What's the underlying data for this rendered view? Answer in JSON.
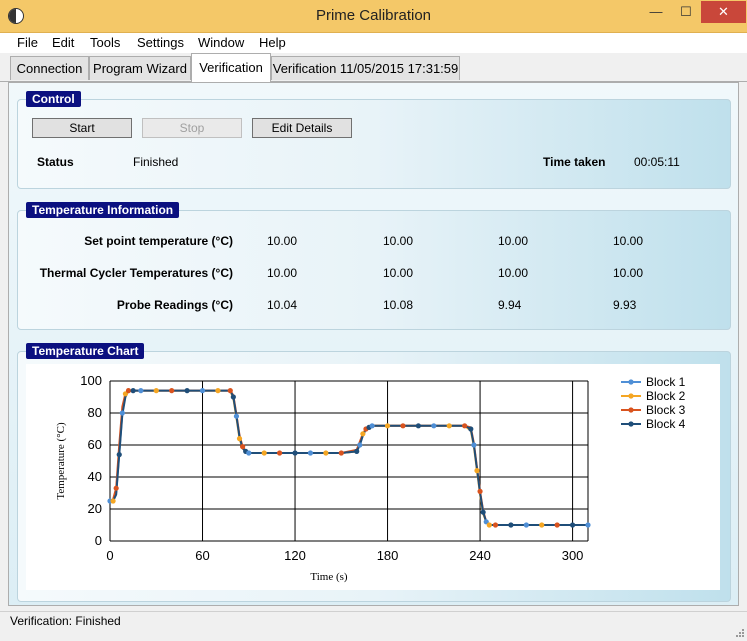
{
  "window": {
    "title": "Prime Calibration",
    "minimize": "—",
    "maximize": "☐",
    "close": "✕"
  },
  "menu": [
    {
      "label": "File"
    },
    {
      "label": "Edit"
    },
    {
      "label": "Tools"
    },
    {
      "label": "Settings"
    },
    {
      "label": "Window"
    },
    {
      "label": "Help"
    }
  ],
  "tabs": [
    {
      "label": "Connection"
    },
    {
      "label": "Program Wizard"
    },
    {
      "label": "Verification"
    },
    {
      "label": "Verification 11/05/2015 17:31:59"
    }
  ],
  "control": {
    "header": "Control",
    "start_label": "Start",
    "stop_label": "Stop",
    "edit_label": "Edit Details",
    "status_label": "Status",
    "status_value": "Finished",
    "time_label": "Time taken",
    "time_value": "00:05:11"
  },
  "temp_info": {
    "header": "Temperature Information",
    "rows": [
      {
        "label": "Set point temperature (°C)",
        "values": [
          "10.00",
          "10.00",
          "10.00",
          "10.00"
        ]
      },
      {
        "label": "Thermal Cycler Temperatures (°C)",
        "values": [
          "10.00",
          "10.00",
          "10.00",
          "10.00"
        ]
      },
      {
        "label": "Probe Readings (°C)",
        "values": [
          "10.04",
          "10.08",
          "9.94",
          "9.93"
        ]
      }
    ]
  },
  "chart_panel": {
    "header": "Temperature Chart"
  },
  "chart_data": {
    "type": "line",
    "xlabel": "Time (s)",
    "ylabel": "Temperature (°C)",
    "xlim": [
      0,
      310
    ],
    "ylim": [
      0,
      100
    ],
    "xticks": [
      0,
      60,
      120,
      180,
      240,
      300
    ],
    "yticks": [
      0,
      20,
      40,
      60,
      80,
      100
    ],
    "grid": true,
    "legend": "top-right",
    "x": [
      0,
      2,
      4,
      6,
      8,
      10,
      12,
      15,
      20,
      30,
      40,
      50,
      60,
      70,
      78,
      80,
      82,
      84,
      86,
      88,
      90,
      100,
      110,
      120,
      130,
      140,
      150,
      160,
      162,
      164,
      166,
      168,
      170,
      180,
      190,
      200,
      210,
      220,
      230,
      234,
      236,
      238,
      240,
      242,
      244,
      246,
      250,
      260,
      270,
      280,
      290,
      300,
      310
    ],
    "series": [
      {
        "name": "Block 1",
        "color": "#4f8fd6",
        "marker": "diamond",
        "values": [
          25,
          25,
          30,
          55,
          80,
          91,
          94,
          94,
          94,
          94,
          94,
          94,
          94,
          94,
          94,
          90,
          78,
          65,
          58,
          56,
          55,
          55,
          55,
          55,
          55,
          55,
          55,
          56,
          60,
          66,
          70,
          71,
          72,
          72,
          72,
          72,
          72,
          72,
          72,
          70,
          60,
          45,
          30,
          18,
          12,
          10,
          10,
          10,
          10,
          10,
          10,
          10,
          10
        ]
      },
      {
        "name": "Block 2",
        "color": "#f5a623",
        "marker": "triangle",
        "values": [
          25,
          25,
          31,
          57,
          82,
          92,
          94,
          94,
          94,
          94,
          94,
          94,
          94,
          94,
          94,
          89,
          77,
          64,
          58,
          56,
          55,
          55,
          55,
          55,
          55,
          55,
          55,
          56,
          61,
          67,
          70,
          71,
          72,
          72,
          72,
          72,
          72,
          72,
          72,
          69,
          59,
          44,
          29,
          17,
          12,
          10,
          10,
          10,
          10,
          10,
          10,
          10,
          10
        ]
      },
      {
        "name": "Block 3",
        "color": "#d9531e",
        "marker": "circle",
        "values": [
          25,
          26,
          33,
          60,
          84,
          92,
          94,
          94,
          94,
          94,
          94,
          94,
          94,
          94,
          94,
          91,
          79,
          66,
          59,
          56,
          55,
          55,
          55,
          55,
          55,
          55,
          55,
          57,
          62,
          67,
          70,
          71,
          72,
          72,
          72,
          72,
          72,
          72,
          72,
          71,
          61,
          46,
          31,
          19,
          12,
          10,
          10,
          10,
          10,
          10,
          10,
          10,
          10
        ]
      },
      {
        "name": "Block 4",
        "color": "#1f4e79",
        "marker": "diamond",
        "values": [
          25,
          25,
          29,
          54,
          79,
          90,
          94,
          94,
          94,
          94,
          94,
          94,
          94,
          94,
          94,
          90,
          78,
          65,
          58,
          56,
          55,
          55,
          55,
          55,
          55,
          55,
          55,
          56,
          60,
          66,
          70,
          71,
          72,
          72,
          72,
          72,
          72,
          72,
          72,
          70,
          60,
          45,
          30,
          18,
          12,
          10,
          10,
          10,
          10,
          10,
          10,
          10,
          10
        ]
      }
    ]
  },
  "statusbar": {
    "text": "Verification: Finished"
  }
}
